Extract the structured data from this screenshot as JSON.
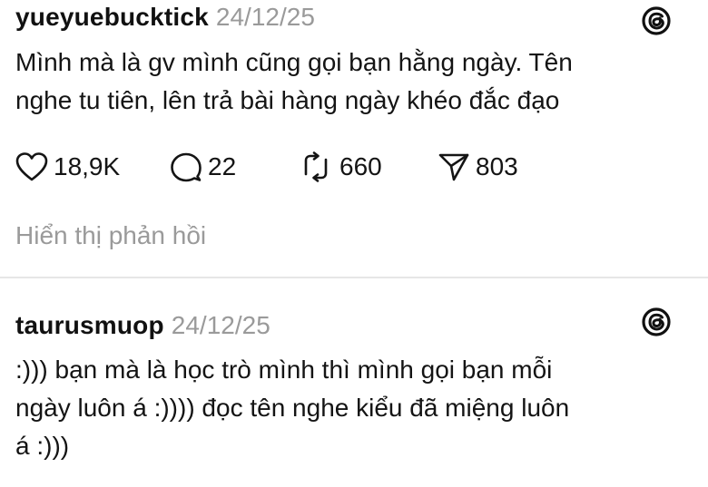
{
  "posts": [
    {
      "username": "yueyuebucktick",
      "timestamp": "24/12/25",
      "text_lines": [
        "Mình mà là gv mình cũng gọi bạn hằng ngày. Tên",
        "nghe tu tiên, lên trả bài hàng ngày khéo đắc đạo"
      ],
      "actions": {
        "likes": "18,9K",
        "replies": "22",
        "reposts": "660",
        "shares": "803"
      },
      "show_replies_label": "Hiển thị phản hồi"
    },
    {
      "username": "taurusmuop",
      "timestamp": "24/12/25",
      "text_lines": [
        ":))) bạn mà là học trò mình thì mình gọi bạn mỗi",
        "ngày luôn á :)))) đọc tên nghe kiểu đã miệng luôn",
        "á :)))"
      ]
    }
  ],
  "icons": {
    "brand": "threads-icon",
    "like": "heart-icon",
    "reply": "comment-bubble-icon",
    "repost": "repost-icon",
    "share": "send-icon"
  },
  "colors": {
    "text": "#141414",
    "muted": "#9a9a9a",
    "divider": "#e6e6e6"
  }
}
